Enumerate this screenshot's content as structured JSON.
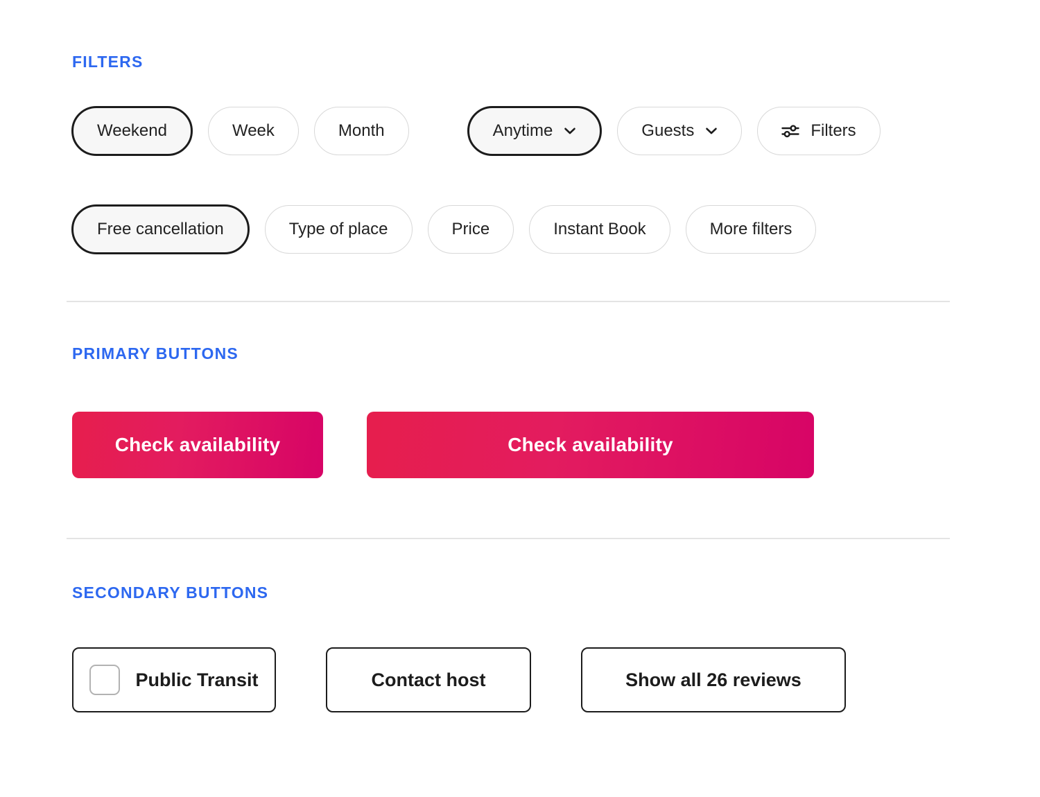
{
  "sections": {
    "filters": {
      "label": "FILTERS",
      "row1": [
        {
          "label": "Weekend",
          "selected": true,
          "icon": null
        },
        {
          "label": "Week",
          "selected": false,
          "icon": null
        },
        {
          "label": "Month",
          "selected": false,
          "icon": null
        },
        {
          "label": "Anytime",
          "selected": true,
          "icon": "chevron-down-icon"
        },
        {
          "label": "Guests",
          "selected": false,
          "icon": "chevron-down-icon"
        },
        {
          "label": "Filters",
          "selected": false,
          "icon": "sliders-icon"
        }
      ],
      "row2": [
        {
          "label": "Free cancellation",
          "selected": true,
          "icon": null
        },
        {
          "label": "Type of place",
          "selected": false,
          "icon": null
        },
        {
          "label": "Price",
          "selected": false,
          "icon": null
        },
        {
          "label": "Instant Book",
          "selected": false,
          "icon": null
        },
        {
          "label": "More filters",
          "selected": false,
          "icon": null
        }
      ]
    },
    "primary_buttons": {
      "label": "PRIMARY BUTTONS",
      "buttons": [
        {
          "label": "Check availability"
        },
        {
          "label": "Check availability"
        }
      ]
    },
    "secondary_buttons": {
      "label": "SECONDARY BUTTONS",
      "buttons": [
        {
          "label": "Public Transit",
          "checkbox": true,
          "checked": false
        },
        {
          "label": "Contact host",
          "checkbox": false,
          "checked": false
        },
        {
          "label": "Show all 26 reviews",
          "checkbox": false,
          "checked": false
        }
      ]
    }
  },
  "colors": {
    "section_label": "#2d68f0",
    "pill_selected_border": "#1c1c1c",
    "pill_selected_fill": "#f7f7f7",
    "pill_border": "#d8d8d8",
    "gradient_start": "#e61e4d",
    "gradient_mid": "#e31c5f",
    "gradient_end": "#d70466",
    "divider": "#e4e4e4",
    "checkbox_border": "#b2b2b2",
    "text": "#222222"
  }
}
